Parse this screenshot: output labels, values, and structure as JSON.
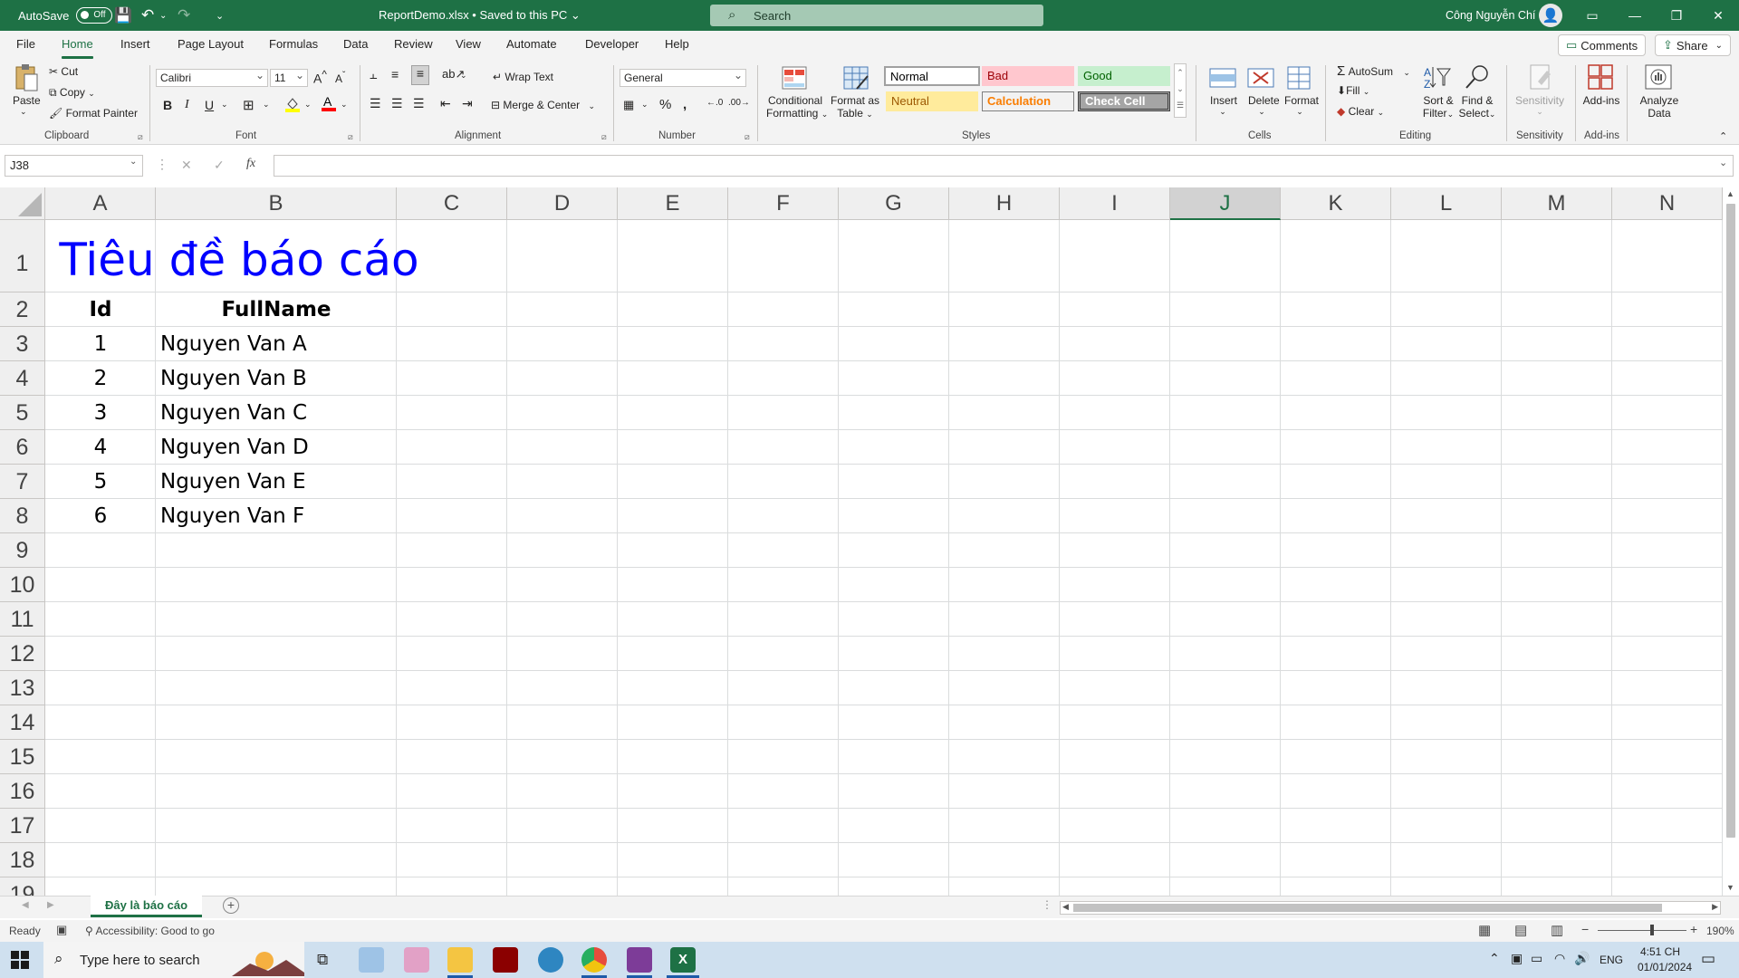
{
  "titlebar": {
    "autosave_label": "AutoSave",
    "autosave_state": "Off",
    "doc_title": "ReportDemo.xlsx • Saved to this PC ⌄",
    "search_placeholder": "Search",
    "user_name": "Công Nguyễn Chí"
  },
  "menu": {
    "tabs": [
      "File",
      "Home",
      "Insert",
      "Page Layout",
      "Formulas",
      "Data",
      "Review",
      "View",
      "Automate",
      "Developer",
      "Help"
    ],
    "active": "Home",
    "comments_label": "Comments",
    "share_label": "Share"
  },
  "ribbon": {
    "clipboard": {
      "paste": "Paste",
      "cut": "Cut",
      "copy": "Copy",
      "format_painter": "Format Painter",
      "label": "Clipboard"
    },
    "font": {
      "name": "Calibri",
      "size": "11",
      "label": "Font"
    },
    "alignment": {
      "wrap_text": "Wrap Text",
      "merge_center": "Merge & Center",
      "label": "Alignment"
    },
    "number": {
      "format": "General",
      "label": "Number"
    },
    "styles": {
      "conditional_line1": "Conditional",
      "conditional_line2": "Formatting",
      "format_table_line1": "Format as",
      "format_table_line2": "Table",
      "normal": "Normal",
      "bad": "Bad",
      "good": "Good",
      "neutral": "Neutral",
      "calculation": "Calculation",
      "check_cell": "Check Cell",
      "label": "Styles"
    },
    "cells": {
      "insert": "Insert",
      "delete": "Delete",
      "format": "Format",
      "label": "Cells"
    },
    "editing": {
      "autosum": "AutoSum",
      "fill": "Fill",
      "clear": "Clear",
      "sort_line1": "Sort &",
      "sort_line2": "Filter",
      "find_line1": "Find &",
      "find_line2": "Select",
      "label": "Editing"
    },
    "sensitivity": {
      "button": "Sensitivity",
      "label": "Sensitivity"
    },
    "addins": {
      "button": "Add-ins",
      "label": "Add-ins"
    },
    "analyze": {
      "line1": "Analyze",
      "line2": "Data"
    }
  },
  "formula_bar": {
    "name_box": "J38",
    "fx": "fx",
    "value": ""
  },
  "sheet": {
    "columns": [
      "A",
      "B",
      "C",
      "D",
      "E",
      "F",
      "G",
      "H",
      "I",
      "J",
      "K",
      "L",
      "M",
      "N"
    ],
    "selected_column": "J",
    "rows": [
      "1",
      "2",
      "3",
      "4",
      "5",
      "6",
      "7",
      "8",
      "9",
      "10",
      "11",
      "12",
      "13",
      "14",
      "15",
      "16",
      "17",
      "18",
      "19"
    ],
    "title": "Tiêu đề báo cáo",
    "header_id": "Id",
    "header_fullname": "FullName",
    "records": [
      {
        "id": "1",
        "name": "Nguyen Van A"
      },
      {
        "id": "2",
        "name": "Nguyen Van B"
      },
      {
        "id": "3",
        "name": "Nguyen Van C"
      },
      {
        "id": "4",
        "name": "Nguyen Van D"
      },
      {
        "id": "5",
        "name": "Nguyen Van E"
      },
      {
        "id": "6",
        "name": "Nguyen Van F"
      }
    ]
  },
  "sheet_tabs": {
    "active": "Đây là báo cáo"
  },
  "status": {
    "ready": "Ready",
    "accessibility": "Accessibility: Good to go",
    "zoom": "190%"
  },
  "taskbar": {
    "search_placeholder": "Type here to search",
    "lang": "ENG",
    "time": "4:51 CH",
    "date": "01/01/2024"
  },
  "colors": {
    "excel_green": "#1e7145",
    "title_blue": "#0000ff"
  }
}
